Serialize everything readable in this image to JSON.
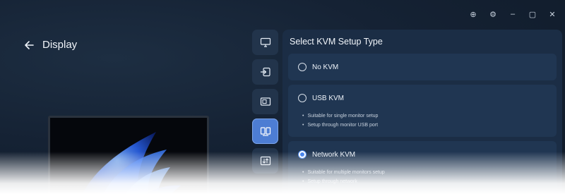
{
  "window": {
    "controls": [
      {
        "name": "add-icon",
        "glyph": "⊕"
      },
      {
        "name": "gear-icon",
        "glyph": "⚙"
      },
      {
        "name": "minimize-icon",
        "glyph": "–"
      },
      {
        "name": "maximize-icon",
        "glyph": "▢"
      },
      {
        "name": "close-icon",
        "glyph": "✕"
      }
    ]
  },
  "header": {
    "title": "Display"
  },
  "rail": {
    "items": [
      {
        "name": "monitor-icon",
        "active": false
      },
      {
        "name": "input-icon",
        "active": false
      },
      {
        "name": "picture-icon",
        "active": false
      },
      {
        "name": "kvm-icon",
        "active": true
      },
      {
        "name": "layout-icon",
        "active": false
      }
    ]
  },
  "kvm": {
    "title": "Select KVM Setup Type",
    "options": [
      {
        "label": "No KVM",
        "checked": false,
        "bullets": []
      },
      {
        "label": "USB KVM",
        "checked": false,
        "bullets": [
          "Suitable for single monitor setup",
          "Setup through monitor USB port"
        ]
      },
      {
        "label": "Network KVM",
        "checked": true,
        "bullets": [
          "Suitable for multiple monitors setup",
          "Setup through network"
        ]
      }
    ]
  },
  "colors": {
    "accent": "#4d7dd3",
    "panel": "#1b2d45",
    "card": "#203652"
  }
}
